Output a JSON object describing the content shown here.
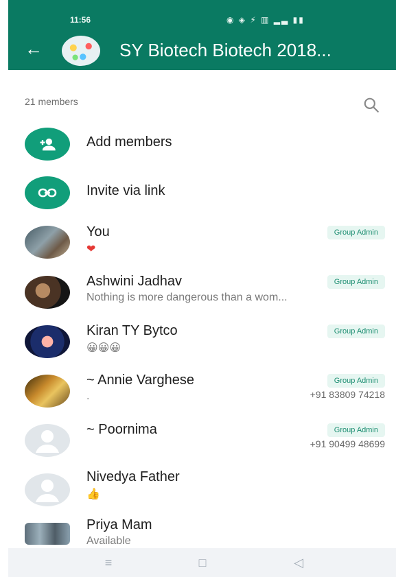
{
  "status_bar": {
    "time": "11:56",
    "icons_text": "◉ ◈ ⚡ ▥ ▂▃ ▮▮"
  },
  "header": {
    "group_title": "SY Biotech Biotech 2018...",
    "back_icon": "arrow-left-icon",
    "avatar": "group-avatar"
  },
  "list": {
    "members_count_label": "21 members",
    "search_icon": "search-icon",
    "actions": [
      {
        "label": "Add members",
        "icon": "add-person-icon"
      },
      {
        "label": "Invite via link",
        "icon": "link-icon"
      }
    ],
    "members": [
      {
        "name": "You",
        "status": "❤",
        "badge": "Group Admin"
      },
      {
        "name": "Ashwini Jadhav",
        "status": "Nothing is more dangerous than a wom...",
        "badge": "Group Admin"
      },
      {
        "name": "Kiran TY Bytco",
        "status": "😀😀😀",
        "badge": "Group Admin"
      },
      {
        "name": "~ Annie Varghese",
        "status": ".",
        "badge": "Group Admin",
        "phone": "+91 83809 74218"
      },
      {
        "name": "~ Poornima",
        "status": "",
        "badge": "Group Admin",
        "phone": "+91 90499 48699"
      },
      {
        "name": "Nivedya Father",
        "status": "👍",
        "badge": ""
      },
      {
        "name": "Priya Mam",
        "status": "Available",
        "badge": ""
      }
    ]
  },
  "navbar": {
    "items": [
      "menu-icon",
      "home-icon",
      "back-icon"
    ],
    "glyphs": [
      "≡",
      "□",
      "◁"
    ]
  },
  "colors": {
    "brand_green": "#0a7a62",
    "action_green": "#119e7a",
    "badge_bg": "#e6f6f1",
    "badge_text": "#1f8f73"
  }
}
